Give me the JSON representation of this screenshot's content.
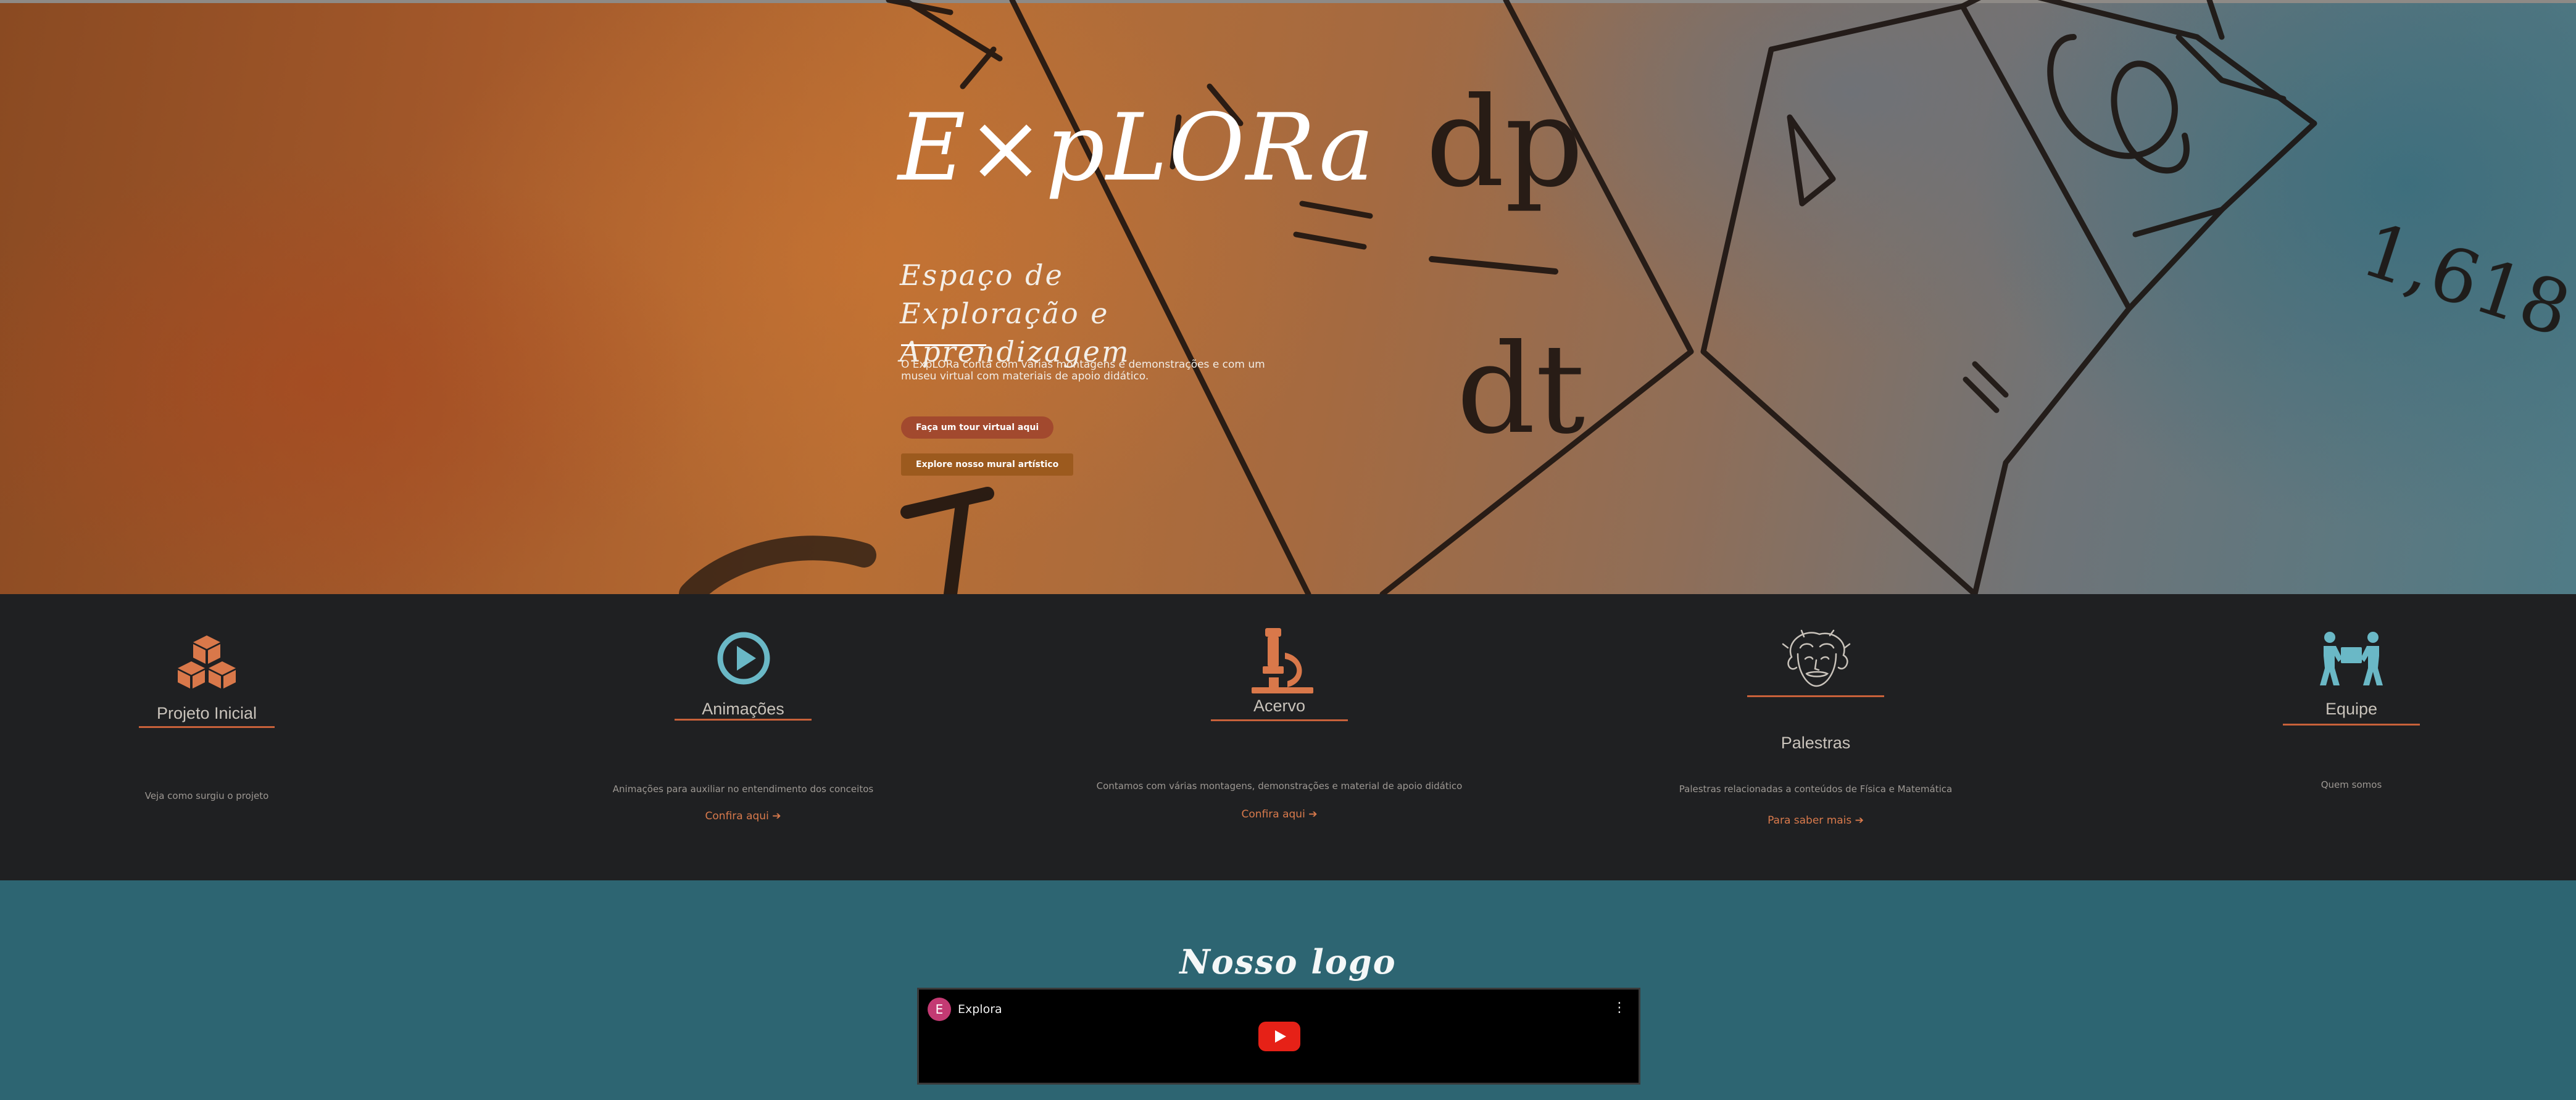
{
  "hero": {
    "title": "E×pLORa",
    "subtitle": "Espaço de Exploração e Aprendizagem",
    "description": "O ExpLORa conta com várias montagens e demonstrações e com um museu virtual com materiais de apoio didático.",
    "btn_tour": "Faça um tour virtual aqui",
    "btn_mural": "Explore nosso mural artístico",
    "art_labels": {
      "dp": "dp",
      "dt": "dt",
      "ratio": "1,618"
    }
  },
  "features": [
    {
      "title": "Projeto Inicial",
      "description": "Veja como surgiu o projeto",
      "link": "",
      "icon": "cubes-icon"
    },
    {
      "title": "Animações",
      "description": "Animações para auxiliar no entendimento dos conceitos",
      "link": "Confira aqui",
      "icon": "play-circle-icon"
    },
    {
      "title": "Acervo",
      "description": "Contamos com várias montagens, demonstrações e material de apoio didático",
      "link": "Confira aqui",
      "icon": "microscope-icon"
    },
    {
      "title": "Palestras",
      "description": "Palestras relacionadas a conteúdos de Física e Matemática",
      "link": "Para saber mais",
      "icon": "einstein-portrait-icon"
    },
    {
      "title": "Equipe",
      "description": "Quem somos",
      "link": "",
      "icon": "people-carry-icon"
    }
  ],
  "logo_section": {
    "title": "Nosso logo",
    "video": {
      "avatar_letter": "E",
      "channel": "Explora",
      "menu": "⋮"
    }
  },
  "colors": {
    "accent_orange": "#c8613a",
    "accent_teal": "#6ab8c6",
    "dark_bg": "#1f2022",
    "teal_bg": "#2d6572",
    "youtube_red": "#e62117"
  }
}
